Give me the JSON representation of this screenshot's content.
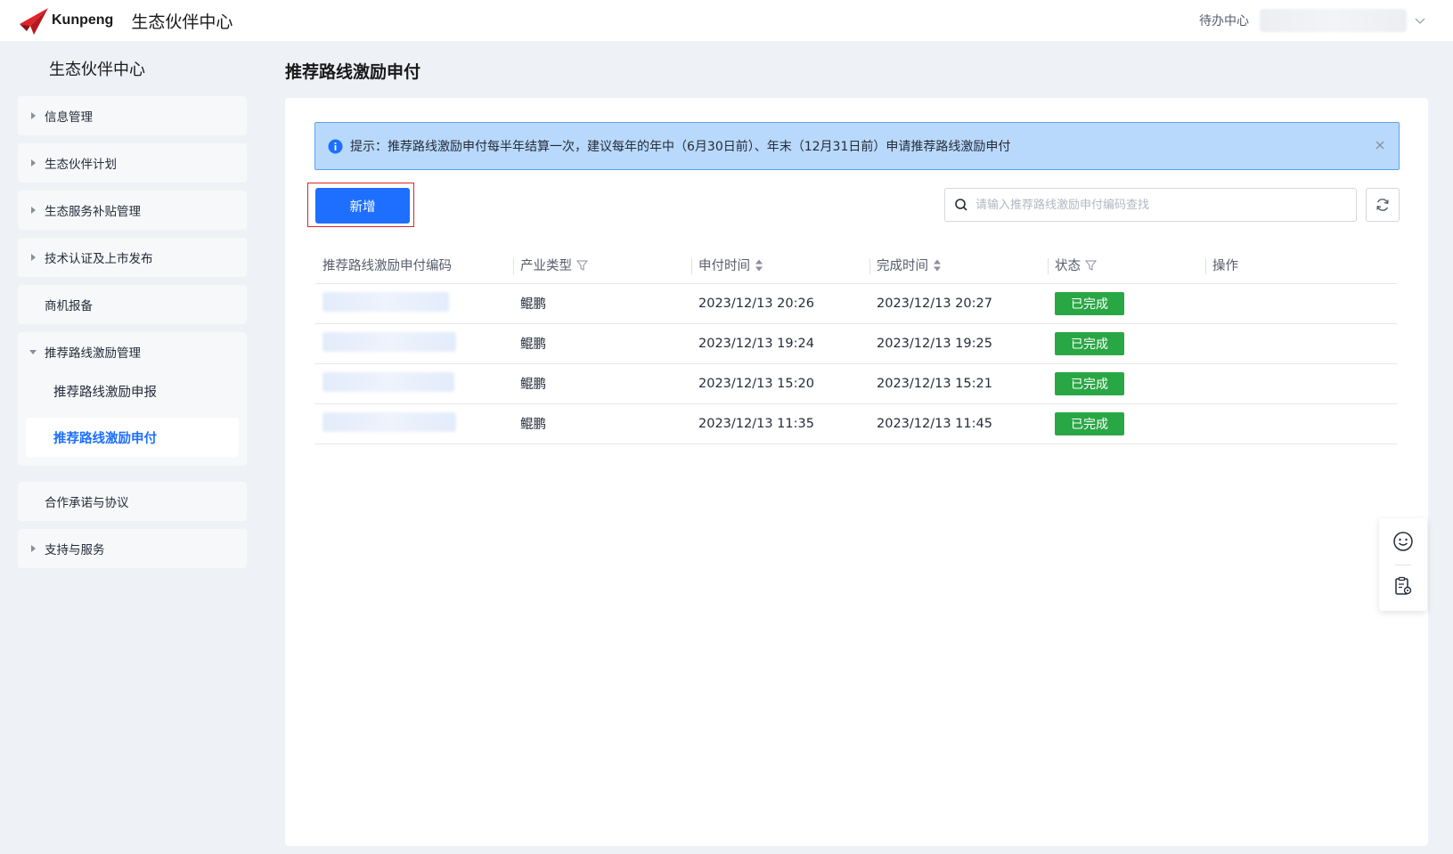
{
  "header": {
    "logo_text": "Kunpeng",
    "app_title": "生态伙伴中心",
    "todo_label": "待办中心"
  },
  "sidebar": {
    "title": "生态伙伴中心",
    "items": [
      {
        "label": "信息管理"
      },
      {
        "label": "生态伙伴计划"
      },
      {
        "label": "生态服务补贴管理"
      },
      {
        "label": "技术认证及上市发布"
      },
      {
        "label": "商机报备"
      },
      {
        "label": "推荐路线激励管理"
      },
      {
        "label": "合作承诺与协议"
      },
      {
        "label": "支持与服务"
      }
    ],
    "subitems": [
      {
        "label": "推荐路线激励申报"
      },
      {
        "label": "推荐路线激励申付"
      }
    ]
  },
  "main": {
    "page_title": "推荐路线激励申付",
    "notice": "提示：推荐路线激励申付每半年结算一次，建议每年的年中（6月30日前）、年末（12月31日前）申请推荐路线激励申付",
    "add_label": "新增",
    "search_placeholder": "请输入推荐路线激励申付编码查找",
    "table": {
      "headers": [
        "推荐路线激励申付编码",
        "产业类型",
        "申付时间",
        "完成时间",
        "状态",
        "操作"
      ],
      "rows": [
        {
          "industry": "鲲鹏",
          "pay_time": "2023/12/13 20:26",
          "done_time": "2023/12/13 20:27",
          "status": "已完成"
        },
        {
          "industry": "鲲鹏",
          "pay_time": "2023/12/13 19:24",
          "done_time": "2023/12/13 19:25",
          "status": "已完成"
        },
        {
          "industry": "鲲鹏",
          "pay_time": "2023/12/13 15:20",
          "done_time": "2023/12/13 15:21",
          "status": "已完成"
        },
        {
          "industry": "鲲鹏",
          "pay_time": "2023/12/13 11:35",
          "done_time": "2023/12/13 11:45",
          "status": "已完成"
        }
      ]
    }
  },
  "colors": {
    "primary": "#1e6fff",
    "status_done": "#2aa745",
    "notice_bg": "#b8d9fb",
    "highlight_outline": "#e02424"
  }
}
